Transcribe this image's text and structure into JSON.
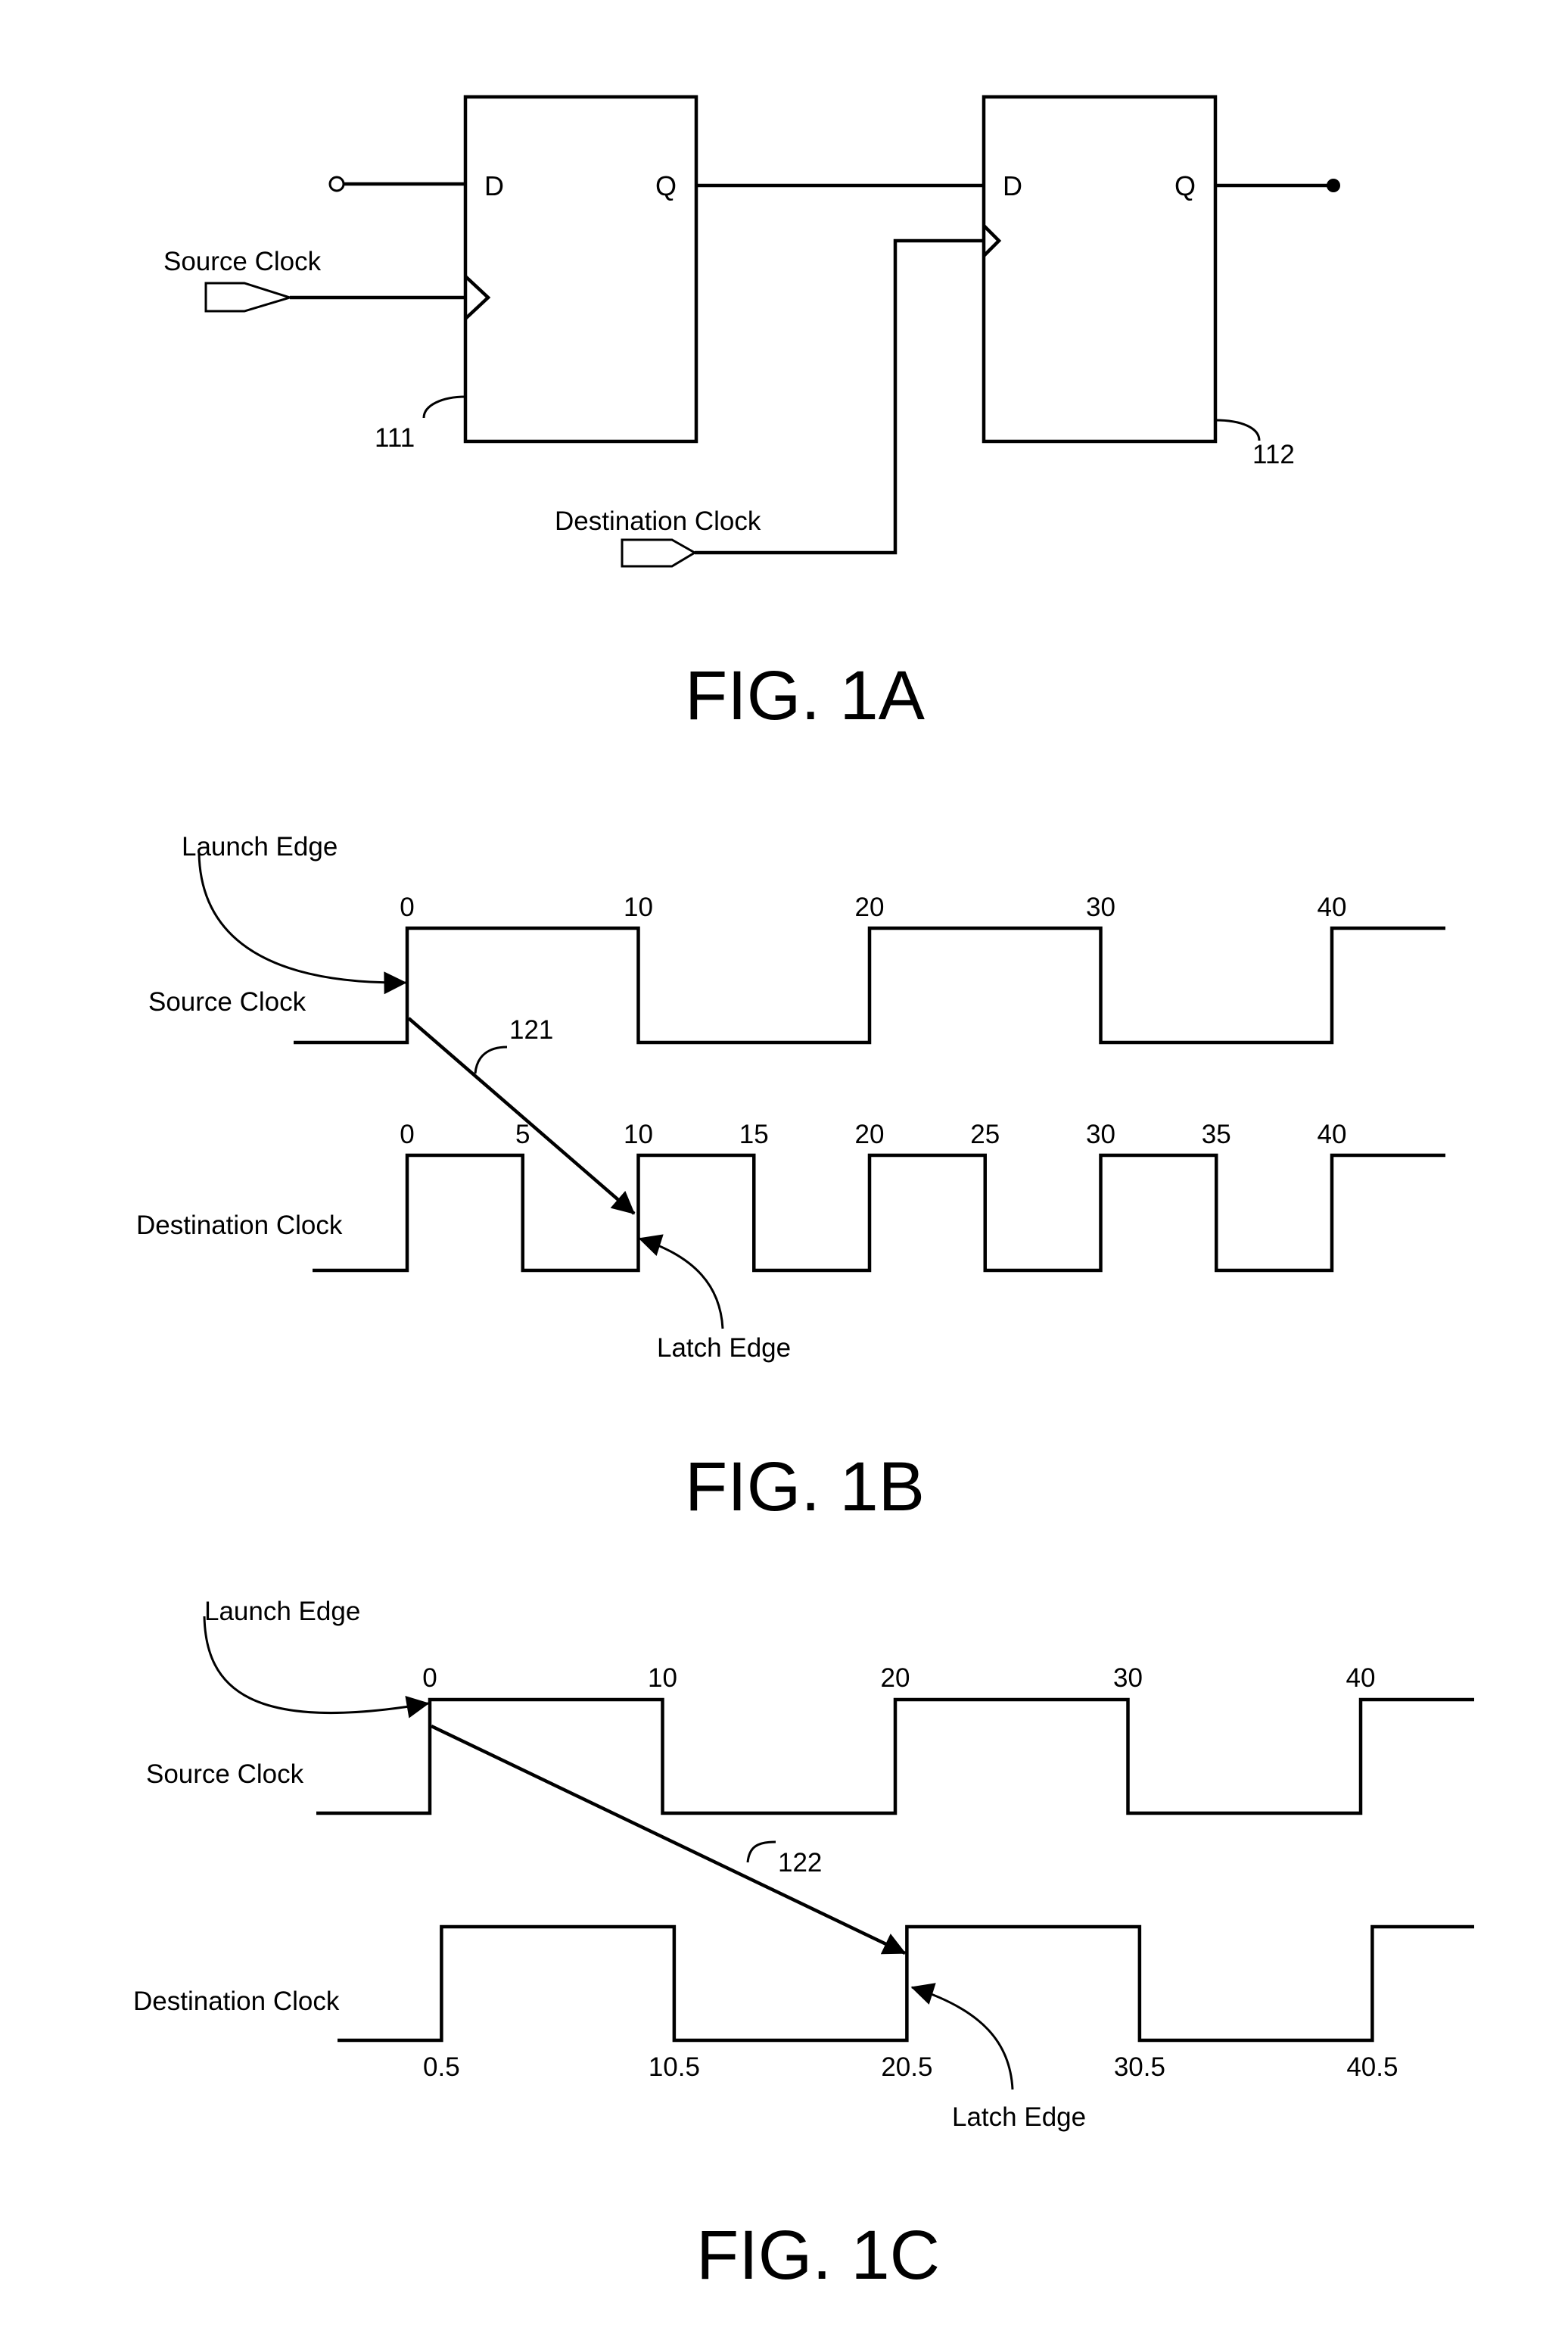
{
  "fig1a": {
    "caption": "FIG. 1A",
    "source_clock_label": "Source Clock",
    "destination_clock_label": "Destination Clock",
    "ff1": {
      "ref": "111",
      "d_label": "D",
      "q_label": "Q"
    },
    "ff2": {
      "ref": "112",
      "d_label": "D",
      "q_label": "Q"
    }
  },
  "fig1b": {
    "caption": "FIG. 1B",
    "launch_label": "Launch Edge",
    "latch_label": "Latch Edge",
    "source_label": "Source Clock",
    "dest_label": "Destination Clock",
    "path_ref": "121",
    "source_period": 20,
    "source_ticks": [
      "0",
      "10",
      "20",
      "30",
      "40"
    ],
    "dest_period": 10,
    "dest_ticks": [
      "0",
      "5",
      "10",
      "15",
      "20",
      "25",
      "30",
      "35",
      "40"
    ],
    "launch_time": 0,
    "latch_time": 10
  },
  "fig1c": {
    "caption": "FIG. 1C",
    "launch_label": "Launch Edge",
    "latch_label": "Latch Edge",
    "source_label": "Source Clock",
    "dest_label": "Destination Clock",
    "path_ref": "122",
    "source_period": 20,
    "source_ticks": [
      "0",
      "10",
      "20",
      "30",
      "40"
    ],
    "dest_period": 20,
    "dest_offset": 0.5,
    "dest_ticks": [
      "0.5",
      "10.5",
      "20.5",
      "30.5",
      "40.5"
    ],
    "launch_time": 0,
    "latch_time": 20.5
  }
}
